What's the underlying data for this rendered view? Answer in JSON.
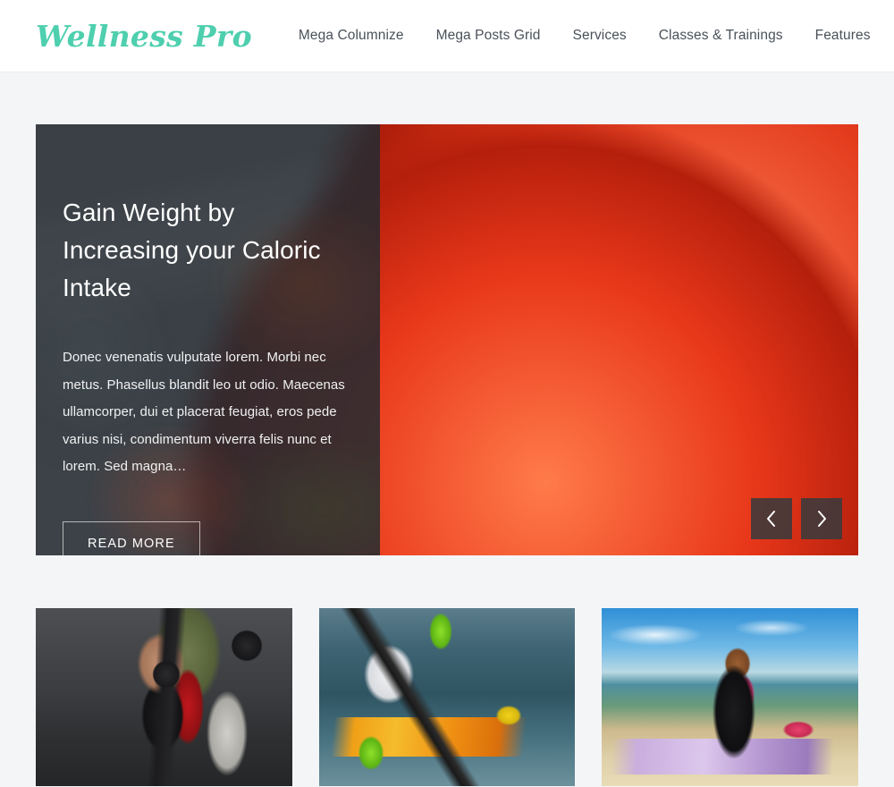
{
  "site": {
    "logo": "Wellness Pro",
    "logo_color": "#4ecfae",
    "background_color": "#f4f5f7"
  },
  "header": {
    "nav_items": [
      {
        "label": "Mega Columnize"
      },
      {
        "label": "Mega Posts Grid"
      },
      {
        "label": "Services"
      },
      {
        "label": "Classes & Trainings"
      },
      {
        "label": "Features"
      }
    ],
    "search_icon": "search-icon"
  },
  "hero": {
    "title": "Gain Weight by Increasing your Caloric Intake",
    "excerpt": "Donec venenatis vulputate lorem. Morbi nec metus. Phasellus blandit leo ut odio. Maecenas ullamcorper, dui et placerat feugiat, eros pede varius nisi, condimentum viverra felis nunc et lorem. Sed magna…",
    "button_label": "READ MORE",
    "overlay_color": "#242b32",
    "prev_icon": "chevron-left-icon",
    "next_icon": "chevron-right-icon",
    "image_alt": "Plate of asparagus, cherry tomatoes, parsley and boiled egg"
  },
  "cards": [
    {
      "name": "card-gym",
      "image_alt": "Woman lifting dumbbells in a gym with a trainer spotting"
    },
    {
      "name": "card-kayak",
      "image_alt": "Man paddling a yellow racing kayak on open water"
    },
    {
      "name": "card-yoga",
      "image_alt": "Woman sitting cross-legged on a yoga mat at the beach"
    }
  ]
}
